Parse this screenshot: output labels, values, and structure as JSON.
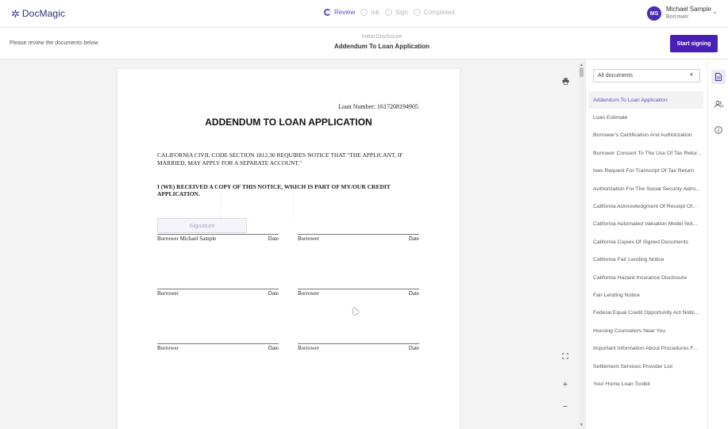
{
  "header": {
    "logo_icon": "star-logo-icon",
    "logo_text": "DocMagic",
    "steps": [
      {
        "label": "Review",
        "state": "active"
      },
      {
        "label": "Ink",
        "state": "pending"
      },
      {
        "label": "Sign",
        "state": "pending"
      },
      {
        "label": "Completed",
        "state": "pending"
      }
    ],
    "user": {
      "initials": "MS",
      "name": "Michael Sample",
      "role": "Borrower"
    }
  },
  "subheader": {
    "instruction": "Please review the documents below",
    "document_group": "Initial Disclosure",
    "document_title": "Addendum To Loan Application",
    "start_button": "Start signing"
  },
  "document": {
    "loan_number": "Loan Number: 1617208194905",
    "title": "ADDENDUM TO LOAN APPLICATION",
    "notice": "CALIFORNIA CIVIL CODE SECTION 1812.30 REQUIRES NOTICE THAT \"THE APPLICANT, IF MARRIED, MAY APPLY FOR A SEPARATE ACCOUNT.\"",
    "received": "I (WE) RECEIVED A COPY OF THIS NOTICE, WHICH IS PART OF MY/OUR CREDIT APPLICATION.",
    "signature_field": "Signature",
    "signature_blocks": [
      {
        "name": "Borrower Michael Sample",
        "date": "Date"
      },
      {
        "name": "Borrower",
        "date": "Date"
      },
      {
        "name": "Borrower",
        "date": "Date"
      },
      {
        "name": "Borrower",
        "date": "Date"
      },
      {
        "name": "Borrower",
        "date": "Date"
      },
      {
        "name": "Borrower",
        "date": "Date"
      }
    ]
  },
  "toolbar": {
    "print_icon": "printer-icon",
    "fit_icon": "fit-screen-icon",
    "zoom_in": "+",
    "zoom_out": "−"
  },
  "sidebar": {
    "filter_value": "All documents",
    "documents": [
      "Addendum To Loan Application",
      "Loan Estimate",
      "Borrower's Certification And Authorization",
      "Borrower Consent To The Use Of Tax Retur...",
      "Ives Request For Transcript Of Tax Return",
      "Authorization For The Social Security Admi...",
      "California Acknowledgment Of Receipt Of...",
      "California Automated Valuation Model Not...",
      "California Copies Of Signed Documents",
      "California Fair Lending Notice",
      "California Hazard Insurance Disclosure",
      "Fair Lending Notice",
      "Federal Equal Credit Opportunity Act Notic...",
      "Housing Counselors Near You",
      "Important Information About Procedures F...",
      "Settlement Services Provider List",
      "Your Home Loan Toolkit"
    ],
    "active_index": 0
  },
  "side_icons": [
    "document-icon",
    "people-icon",
    "info-icon"
  ],
  "colors": {
    "brand": "#4a1fb8",
    "accent": "#5b4fc2"
  }
}
